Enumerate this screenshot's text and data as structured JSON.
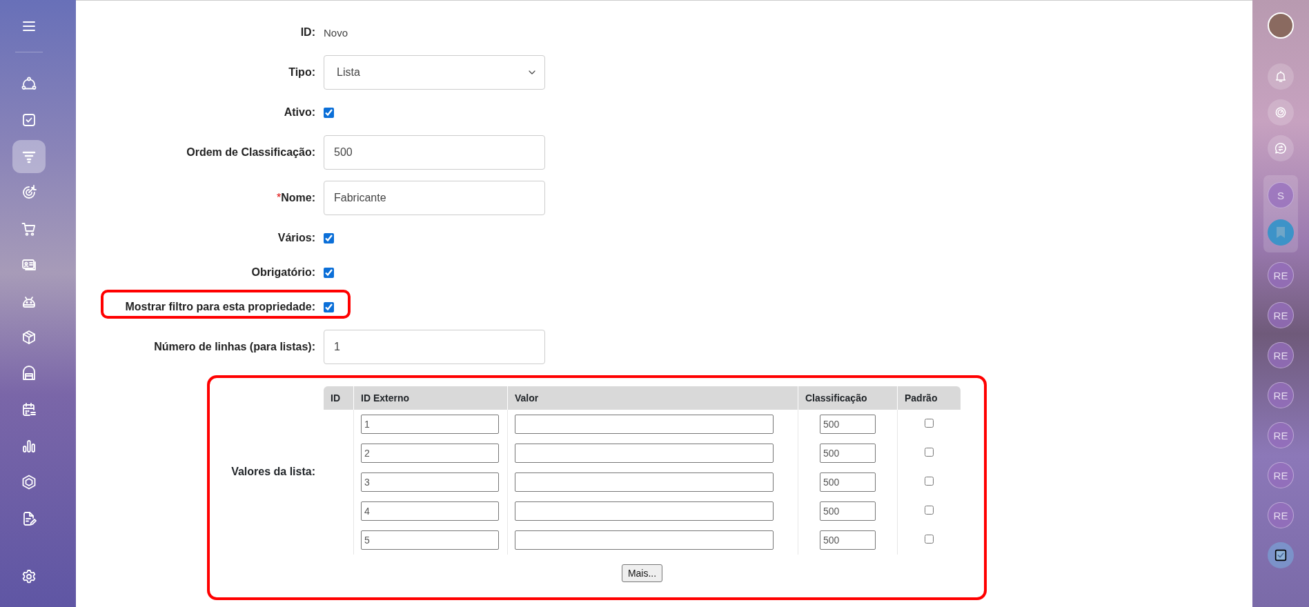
{
  "left_sidebar": {
    "items": [
      {
        "selected": false
      },
      {
        "selected": false
      },
      {
        "selected": true
      },
      {
        "selected": false
      },
      {
        "selected": false
      },
      {
        "selected": false
      },
      {
        "selected": false
      },
      {
        "selected": false
      },
      {
        "selected": false
      },
      {
        "selected": false
      },
      {
        "selected": false
      },
      {
        "selected": false
      },
      {
        "selected": false
      }
    ]
  },
  "form": {
    "fields": [
      {
        "kind": "text",
        "label": "ID:",
        "value": "Novo",
        "highlighted": false
      },
      {
        "kind": "select",
        "label": "Tipo:",
        "value": "Lista",
        "highlighted": false
      },
      {
        "kind": "checkbox",
        "label": "Ativo:",
        "checked": true,
        "highlighted": false
      },
      {
        "kind": "input",
        "label": "Ordem de Classificação:",
        "value": "500",
        "highlighted": false
      },
      {
        "kind": "input",
        "label": "Nome:",
        "required_mark": "*",
        "value": "Fabricante",
        "highlighted": false
      },
      {
        "kind": "checkbox",
        "label": "Vários:",
        "checked": true,
        "highlighted": false
      },
      {
        "kind": "checkbox",
        "label": "Obrigatório:",
        "checked": true,
        "highlighted": false
      },
      {
        "kind": "checkbox",
        "label": "Mostrar filtro para esta propriedade:",
        "checked": true,
        "highlighted": true
      },
      {
        "kind": "input",
        "label": "Número de linhas (para listas):",
        "value": "1",
        "highlighted": false
      }
    ]
  },
  "list_values": {
    "label": "Valores da lista:",
    "highlighted": true,
    "columns": [
      "ID",
      "ID Externo",
      "Valor",
      "Classificação",
      "Padrão"
    ],
    "rows": [
      {
        "external_id": "1",
        "order": "500",
        "default": false
      },
      {
        "external_id": "2",
        "order": "500",
        "default": false
      },
      {
        "external_id": "3",
        "order": "500",
        "default": false
      },
      {
        "external_id": "4",
        "order": "500",
        "default": false
      },
      {
        "external_id": "5",
        "order": "500",
        "default": false
      }
    ],
    "more_button": "Mais..."
  },
  "right_sidebar": {
    "pinned": [
      {
        "kind": "initials",
        "text": "S"
      },
      {
        "kind": "bookmark"
      }
    ],
    "recent": [
      {
        "text": "RE"
      },
      {
        "text": "RE"
      },
      {
        "text": "RE"
      },
      {
        "text": "RE"
      },
      {
        "text": "RE"
      },
      {
        "text": "RE"
      },
      {
        "text": "RE"
      }
    ]
  }
}
